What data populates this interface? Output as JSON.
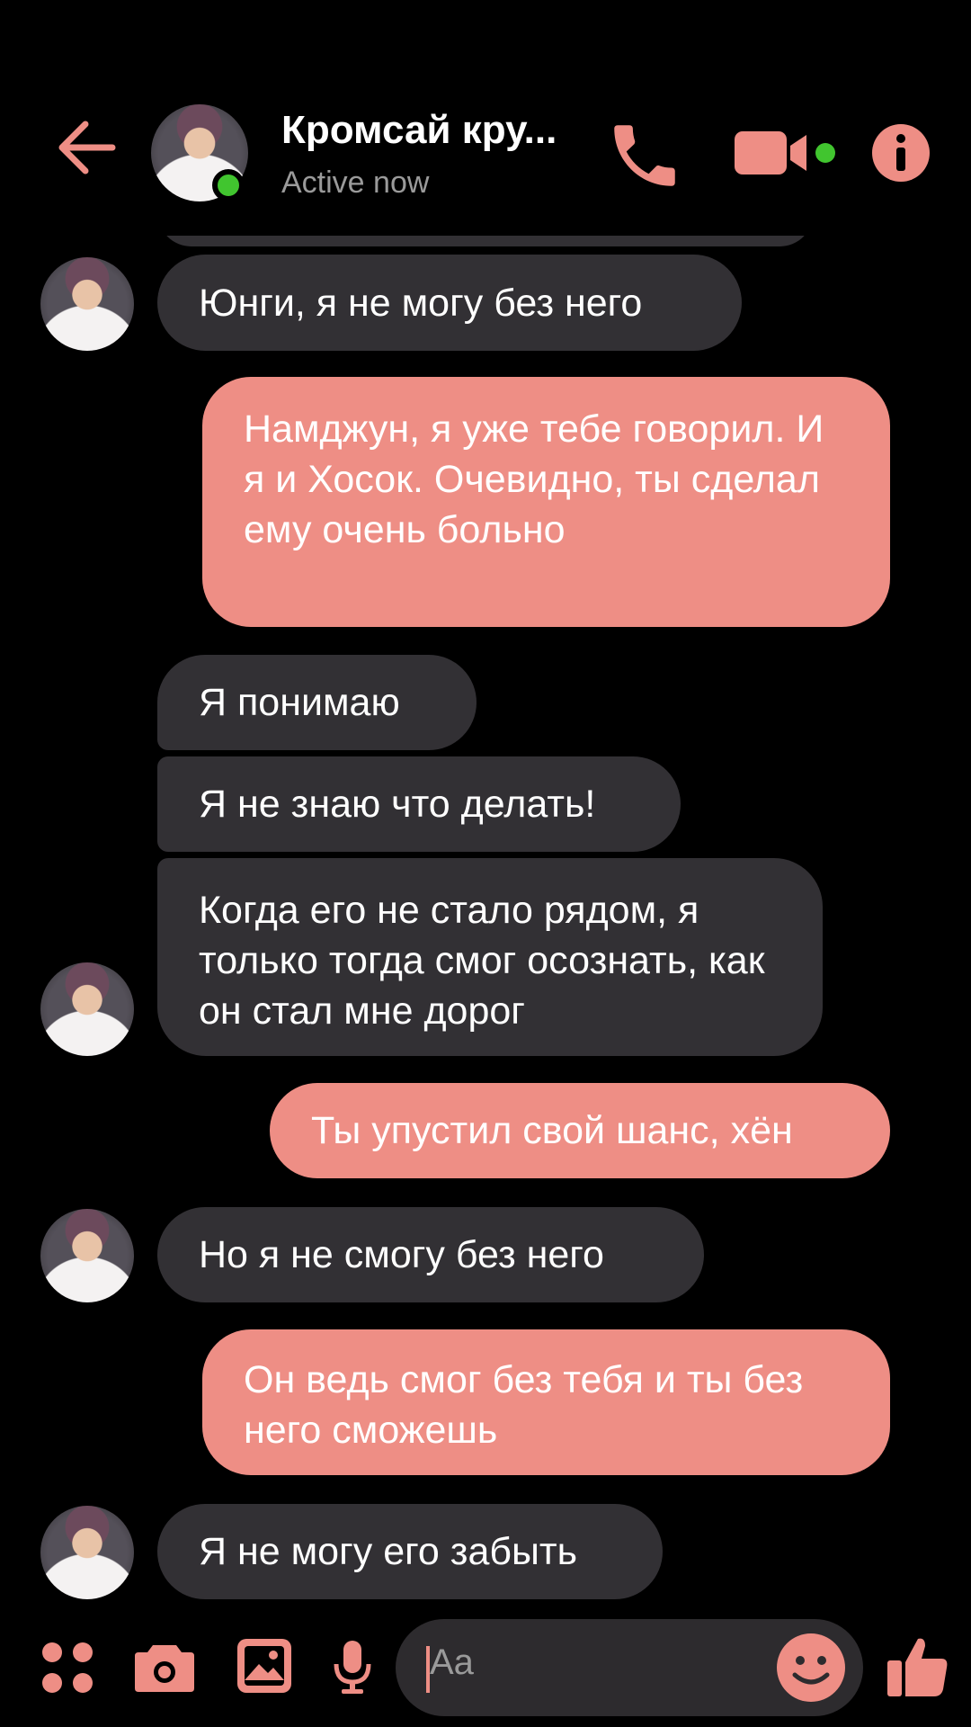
{
  "header": {
    "contact_name": "Кромсай кру...",
    "status": "Active now",
    "accent_color": "#ee8e85",
    "online_color": "#41c52f",
    "icons": [
      "back-arrow-icon",
      "phone-icon",
      "video-camera-icon",
      "info-icon"
    ]
  },
  "messages": [
    {
      "direction": "in",
      "text": "Юнги, я не могу без него"
    },
    {
      "direction": "out",
      "text": "Намджун, я уже тебе говорил. И я и Хосок. Очевидно, ты сделал ему очень больно"
    },
    {
      "direction": "in",
      "text": "Я понимаю"
    },
    {
      "direction": "in",
      "text": "Я не знаю что делать!"
    },
    {
      "direction": "in",
      "text": "Когда его не стало рядом, я только тогда смог осознать, как он стал мне дорог"
    },
    {
      "direction": "out",
      "text": "Ты упустил свой шанс, хён"
    },
    {
      "direction": "in",
      "text": "Но я не смогу без него"
    },
    {
      "direction": "out",
      "text": "Он ведь смог без тебя и ты без него сможешь"
    },
    {
      "direction": "in",
      "text": "Я не могу его забыть"
    }
  ],
  "composer": {
    "placeholder": "Aa",
    "icons": [
      "apps-icon",
      "camera-icon",
      "gallery-icon",
      "microphone-icon",
      "emoji-icon",
      "thumbs-up-icon"
    ]
  },
  "colors": {
    "background": "#000000",
    "incoming_bubble": "#323034",
    "outgoing_bubble": "#ee8e85"
  }
}
